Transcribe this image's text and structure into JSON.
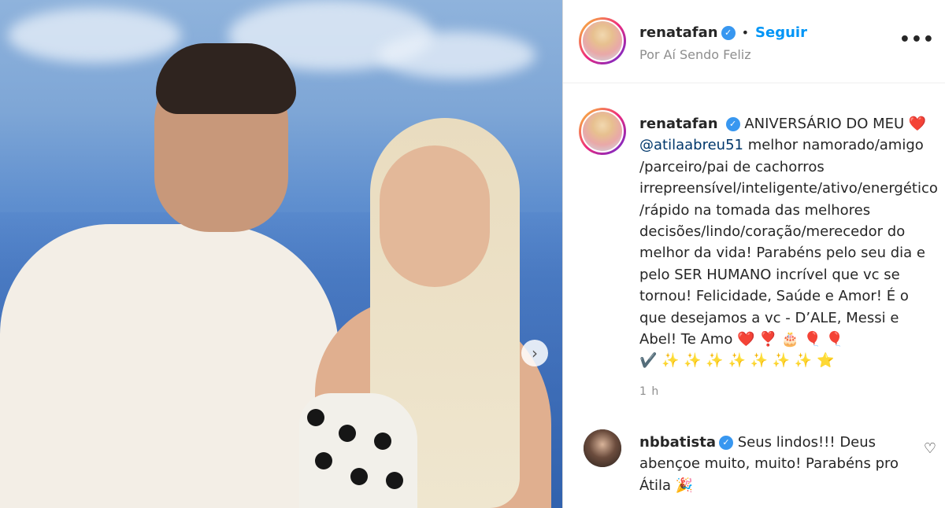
{
  "post": {
    "username": "renatafan",
    "follow_label": "Seguir",
    "location": "Por Aí Sendo Feliz",
    "more_label": "•••",
    "caption": {
      "username": "renatafan",
      "text_before_mention": "ANIVERSÁRIO DO MEU ❤️",
      "mention": "@atilaabreu51",
      "lines": [
        " melhor namorado/amigo",
        "/parceiro/pai de cachorros",
        "irrepreensível/inteligente/ativo/energético",
        "/rápido na tomada das melhores",
        "decisões/lindo/coração/merecedor do",
        "melhor da vida! Parabéns pelo seu dia e",
        "pelo SER HUMANO incrível que vc se",
        "tornou! Felicidade, Saúde e Amor! É o",
        "que desejamos a vc - D’ALE, Messi e",
        "Abel! Te Amo ❤️ ❣️ 🎂 🎈 🎈",
        "✔️ ✨ ✨ ✨ ✨ ✨ ✨ ✨ ⭐"
      ]
    },
    "time": "1 h"
  },
  "comment": {
    "username": "nbbatista",
    "text": "Seus lindos!!! Deus abençoe muito, muito! Parabéns pro Átila 🎉"
  },
  "icons": {
    "next": "chevron-right-icon",
    "verified": "verified-badge-icon",
    "like": "heart-outline-icon"
  },
  "colors": {
    "link": "#0095f6",
    "mention": "#00376b",
    "verified": "#3897f0",
    "meta": "#8e8e8e"
  }
}
